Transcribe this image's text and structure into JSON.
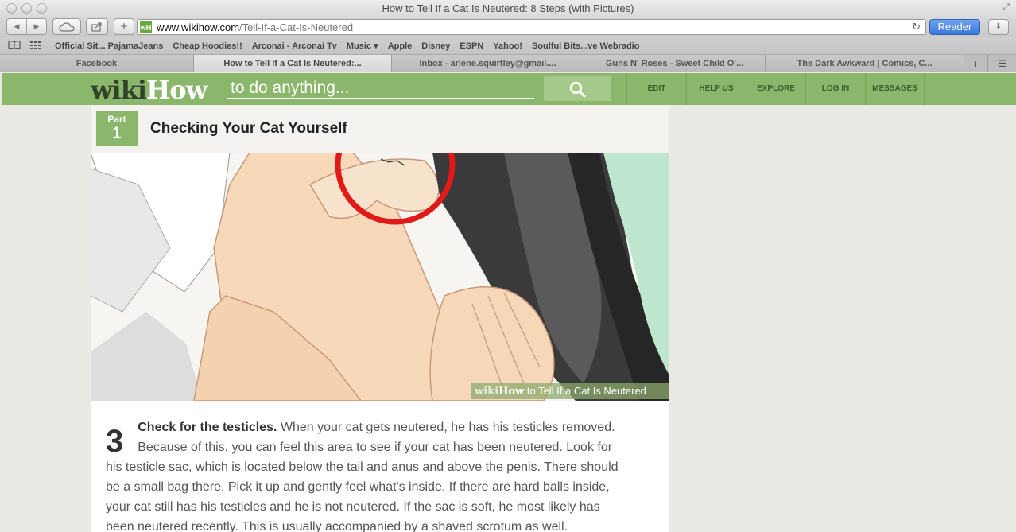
{
  "window": {
    "title": "How to Tell If a Cat Is Neutered: 8 Steps (with Pictures)"
  },
  "toolbar": {
    "url_domain": "www.wikihow.com",
    "url_path": "/Tell-If-a-Cat-Is-Neutered",
    "favicon_text": "wH",
    "reader_label": "Reader",
    "icons": [
      "back-icon",
      "forward-icon",
      "icloud-icon",
      "share-icon",
      "add-icon",
      "reload-icon",
      "download-icon"
    ]
  },
  "bookmarks": [
    "Official Sit... PajamaJeans",
    "Cheap Hoodies!!",
    "Arconai - Arconai Tv",
    "Music ▾",
    "Apple",
    "Disney",
    "ESPN",
    "Yahoo!",
    "Soulful Bits...ve Webradio"
  ],
  "tabs": [
    {
      "label": "Facebook",
      "active": false
    },
    {
      "label": "How to Tell If a Cat Is Neutered:...",
      "active": true
    },
    {
      "label": "Inbox - arlene.squirtley@gmail....",
      "active": false
    },
    {
      "label": "Guns N' Roses - Sweet Child O'...",
      "active": false
    },
    {
      "label": "The Dark Awkward | Comics, C...",
      "active": false
    }
  ],
  "wikihow": {
    "logo_wiki": "wiki",
    "logo_how": "How",
    "search_placeholder": "to do anything...",
    "nav": [
      "EDIT",
      "HELP US",
      "EXPLORE",
      "LOG IN",
      "MESSAGES"
    ],
    "accent_color": "#8bb76c"
  },
  "article": {
    "part_label": "Part",
    "part_number": "1",
    "part_title": "Checking Your Cat Yourself",
    "watermark_wiki": "wiki",
    "watermark_how": "How",
    "watermark_text": " to Tell If a Cat Is Neutered",
    "step_number": "3",
    "step_bold": "Check for the testicles.",
    "step_text": " When your cat gets neutered, he has his testicles removed. Because of this, you can feel this area to see if your cat has been neutered. Look for his testicle sac, which is located below the tail and anus and above the penis. There should be a small bag there. Pick it up and gently feel what's inside. If there are hard balls inside, your cat still has his testicles and he is not neutered. If the sac is soft, he most likely has been neutered recently. This is usually accompanied by a shaved scrotum as well."
  }
}
